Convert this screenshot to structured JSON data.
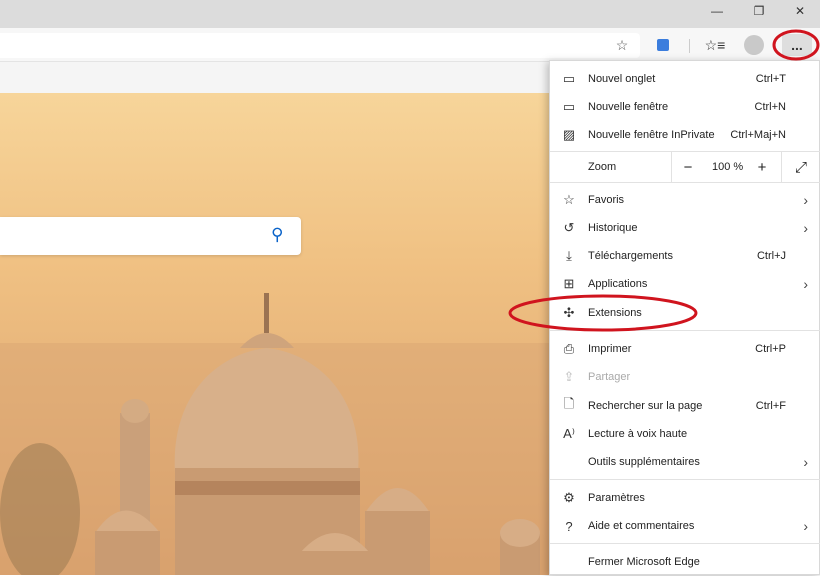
{
  "window": {
    "minimize_icon": "minimize-icon",
    "restore_icon": "restore-icon",
    "close_icon": "close-icon"
  },
  "toolbar": {
    "favorite_icon": "star-plus-icon",
    "translate_icon": "translate-icon",
    "favorites_icon": "favorites-list-icon",
    "profile_icon": "avatar-icon",
    "more_label": "..."
  },
  "menu": {
    "new_tab": {
      "label": "Nouvel onglet",
      "shortcut": "Ctrl+T"
    },
    "new_window": {
      "label": "Nouvelle fenêtre",
      "shortcut": "Ctrl+N"
    },
    "inprivate": {
      "label": "Nouvelle fenêtre InPrivate",
      "shortcut": "Ctrl+Maj+N"
    },
    "zoom": {
      "label": "Zoom",
      "value": "100 %",
      "minus": "−",
      "plus": "+"
    },
    "favorites": {
      "label": "Favoris"
    },
    "history": {
      "label": "Historique"
    },
    "downloads": {
      "label": "Téléchargements",
      "shortcut": "Ctrl+J"
    },
    "apps": {
      "label": "Applications"
    },
    "extensions": {
      "label": "Extensions"
    },
    "print": {
      "label": "Imprimer",
      "shortcut": "Ctrl+P"
    },
    "share": {
      "label": "Partager"
    },
    "find": {
      "label": "Rechercher sur la page",
      "shortcut": "Ctrl+F"
    },
    "read_aloud": {
      "label": "Lecture à voix haute"
    },
    "more_tools": {
      "label": "Outils supplémentaires"
    },
    "settings": {
      "label": "Paramètres"
    },
    "help": {
      "label": "Aide et commentaires"
    },
    "close": {
      "label": "Fermer Microsoft Edge"
    }
  },
  "colors": {
    "annotation": "#d0141e",
    "accent": "#0a63c9"
  }
}
